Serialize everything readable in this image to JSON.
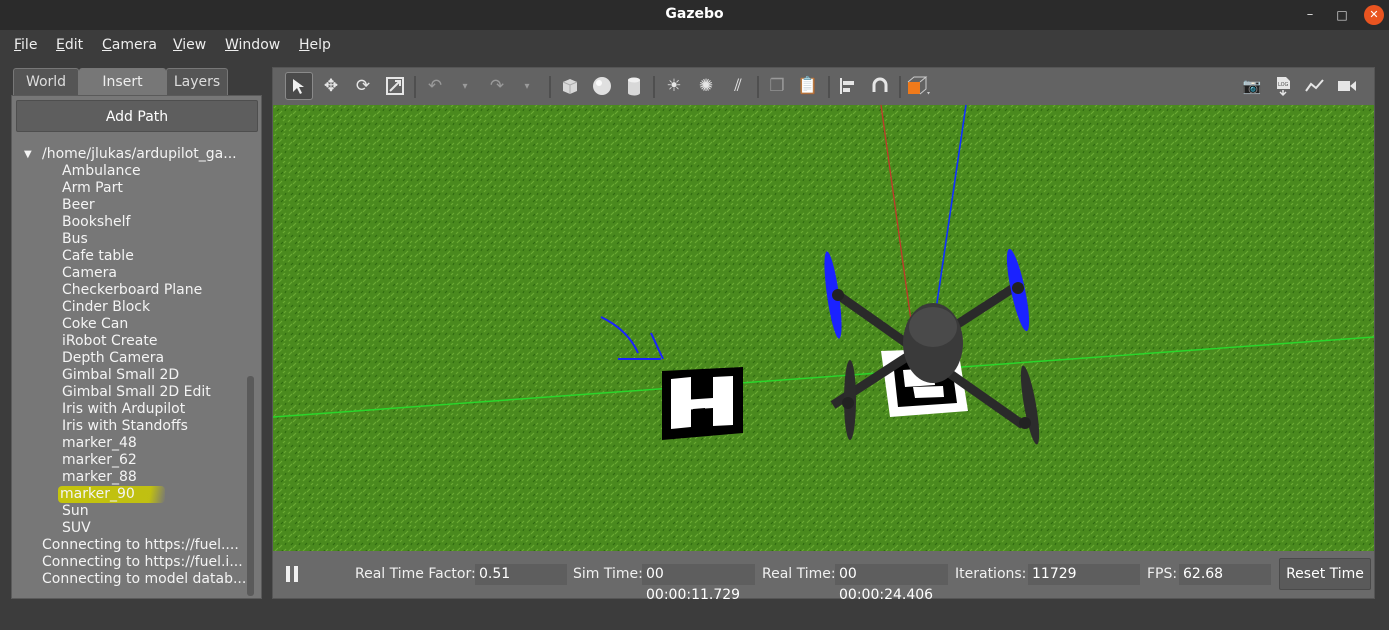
{
  "window": {
    "title": "Gazebo",
    "minimize": "–",
    "maximize": "□",
    "close": "✕"
  },
  "menu": [
    "File",
    "Edit",
    "Camera",
    "View",
    "Window",
    "Help"
  ],
  "tabs": [
    {
      "label": "World",
      "active": false
    },
    {
      "label": "Insert",
      "active": true
    },
    {
      "label": "Layers",
      "active": false
    }
  ],
  "insert": {
    "add_path": "Add Path",
    "path": "/home/jlukas/ardupilot_ga...",
    "models": [
      "Ambulance",
      "Arm Part",
      "Beer",
      "Bookshelf",
      "Bus",
      "Cafe table",
      "Camera",
      "Checkerboard Plane",
      "Cinder Block",
      "Coke Can",
      "iRobot Create",
      "Depth Camera",
      "Gimbal Small 2D",
      "Gimbal Small 2D Edit",
      "Iris with Ardupilot",
      "Iris with Standoffs",
      "marker_48",
      "marker_62",
      "marker_88",
      "marker_90",
      "Sun",
      "SUV"
    ],
    "highlighted": "marker_90",
    "status": [
      "Connecting to https://fuel....",
      "Connecting to https://fuel.i...",
      "Connecting to model datab..."
    ]
  },
  "toolbar": {
    "tools": [
      "select-arrow",
      "translate",
      "rotate",
      "scale",
      "undo",
      "undo-dropdown",
      "redo",
      "redo-dropdown",
      "box",
      "sphere",
      "cylinder",
      "point-light",
      "spot-light",
      "directional-light",
      "copy",
      "paste",
      "align",
      "snap",
      "view-angle"
    ],
    "right": [
      "screenshot",
      "log",
      "plot",
      "video-record"
    ]
  },
  "scene": {
    "ground_color": "#4a8a1e",
    "marker_left": "marker_90",
    "drone": "Iris with Ardupilot"
  },
  "status": {
    "rtf_label": "Real Time Factor:",
    "rtf": "0.51",
    "sim_label": "Sim Time:",
    "sim": "00 00:00:11.729",
    "real_label": "Real Time:",
    "real": "00 00:00:24.406",
    "iter_label": "Iterations:",
    "iter": "11729",
    "fps_label": "FPS:",
    "fps": "62.68",
    "reset": "Reset Time"
  },
  "colors": {
    "highlight": "#cccc00",
    "rotor": "#1a22ff",
    "axis_x": "#c0392b",
    "axis_y": "#22e022",
    "axis_z": "#1030ff"
  }
}
